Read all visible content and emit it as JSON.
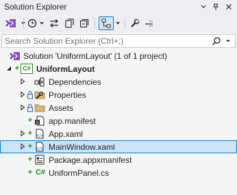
{
  "window": {
    "title": "Solution Explorer"
  },
  "search": {
    "placeholder": "Search Solution Explorer (Ctrl+;)"
  },
  "tree": {
    "solution_label": "Solution 'UniformLayout' (1 of 1 project)",
    "project_badge": "C#",
    "project_label": "UniformLayout",
    "items": [
      {
        "label": "Dependencies"
      },
      {
        "label": "Properties"
      },
      {
        "label": "Assets"
      },
      {
        "label": "app.manifest"
      },
      {
        "label": "App.xaml"
      },
      {
        "label": "MainWindow.xaml"
      },
      {
        "label": "Package.appxmanifest"
      },
      {
        "label": "UniformPanel.cs",
        "badge": "C#"
      }
    ]
  },
  "colors": {
    "accent": "#0078d4",
    "selection": "#cce4f7",
    "git_add": "#1c8a1c",
    "background": "#f5f5f5"
  }
}
